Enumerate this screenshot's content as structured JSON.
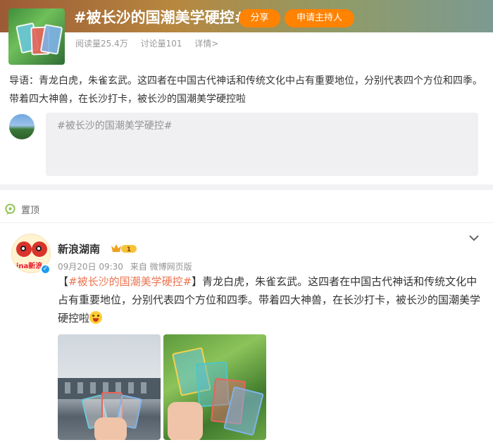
{
  "topic": {
    "title": "#被长沙的国潮美学硬控#",
    "share_label": "分享",
    "apply_host_label": "申请主持人",
    "stats": {
      "reads": "阅读量25.4万",
      "discussions": "讨论量101",
      "details_link": "详情>"
    },
    "guide": "导语：青龙白虎，朱雀玄武。这四者在中国古代神话和传统文化中占有重要地位，分别代表四个方位和四季。带着四大神兽，在长沙打卡，被长沙的国潮美学硬控啦"
  },
  "composer": {
    "prefill": "#被长沙的国潮美学硬控#"
  },
  "pinned": {
    "label": "置顶"
  },
  "post": {
    "author": "新浪湖南",
    "vip_level": "1",
    "avatar_text": "ina新浪",
    "time": "09月20日 09:30",
    "source": "来自 微博网页版",
    "text_open_bracket": "【",
    "hashtag": "#被长沙的国潮美学硬控#",
    "text_body": "】青龙白虎，朱雀玄武。这四者在中国古代神话和传统文化中占有重要地位，分别代表四个方位和四季。带着四大神兽，在长沙打卡，被长沙的国潮美学硬控啦"
  },
  "colors": {
    "accent": "#ff8200",
    "hashtag": "#eb7350",
    "verified": "#1d9bf0"
  },
  "icons": [
    "pin-icon",
    "vip-badge-icon",
    "verified-icon",
    "chevron-down-icon",
    "emoji-icon"
  ]
}
